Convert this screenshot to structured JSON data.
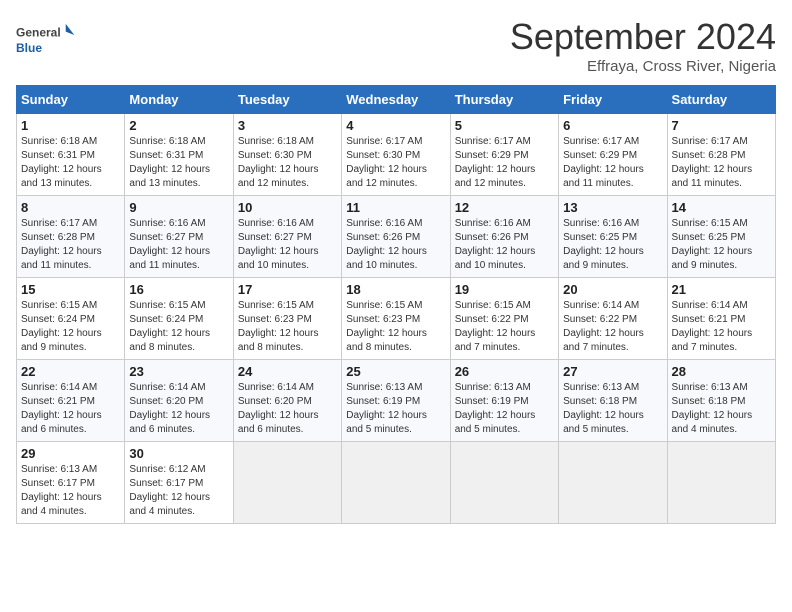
{
  "logo": {
    "general": "General",
    "blue": "Blue"
  },
  "title": "September 2024",
  "subtitle": "Effraya, Cross River, Nigeria",
  "days_of_week": [
    "Sunday",
    "Monday",
    "Tuesday",
    "Wednesday",
    "Thursday",
    "Friday",
    "Saturday"
  ],
  "weeks": [
    [
      {
        "num": "1",
        "rise": "6:18 AM",
        "set": "6:31 PM",
        "daylight": "12 hours and 13 minutes."
      },
      {
        "num": "2",
        "rise": "6:18 AM",
        "set": "6:31 PM",
        "daylight": "12 hours and 13 minutes."
      },
      {
        "num": "3",
        "rise": "6:18 AM",
        "set": "6:30 PM",
        "daylight": "12 hours and 12 minutes."
      },
      {
        "num": "4",
        "rise": "6:17 AM",
        "set": "6:30 PM",
        "daylight": "12 hours and 12 minutes."
      },
      {
        "num": "5",
        "rise": "6:17 AM",
        "set": "6:29 PM",
        "daylight": "12 hours and 12 minutes."
      },
      {
        "num": "6",
        "rise": "6:17 AM",
        "set": "6:29 PM",
        "daylight": "12 hours and 11 minutes."
      },
      {
        "num": "7",
        "rise": "6:17 AM",
        "set": "6:28 PM",
        "daylight": "12 hours and 11 minutes."
      }
    ],
    [
      {
        "num": "8",
        "rise": "6:17 AM",
        "set": "6:28 PM",
        "daylight": "12 hours and 11 minutes."
      },
      {
        "num": "9",
        "rise": "6:16 AM",
        "set": "6:27 PM",
        "daylight": "12 hours and 11 minutes."
      },
      {
        "num": "10",
        "rise": "6:16 AM",
        "set": "6:27 PM",
        "daylight": "12 hours and 10 minutes."
      },
      {
        "num": "11",
        "rise": "6:16 AM",
        "set": "6:26 PM",
        "daylight": "12 hours and 10 minutes."
      },
      {
        "num": "12",
        "rise": "6:16 AM",
        "set": "6:26 PM",
        "daylight": "12 hours and 10 minutes."
      },
      {
        "num": "13",
        "rise": "6:16 AM",
        "set": "6:25 PM",
        "daylight": "12 hours and 9 minutes."
      },
      {
        "num": "14",
        "rise": "6:15 AM",
        "set": "6:25 PM",
        "daylight": "12 hours and 9 minutes."
      }
    ],
    [
      {
        "num": "15",
        "rise": "6:15 AM",
        "set": "6:24 PM",
        "daylight": "12 hours and 9 minutes."
      },
      {
        "num": "16",
        "rise": "6:15 AM",
        "set": "6:24 PM",
        "daylight": "12 hours and 8 minutes."
      },
      {
        "num": "17",
        "rise": "6:15 AM",
        "set": "6:23 PM",
        "daylight": "12 hours and 8 minutes."
      },
      {
        "num": "18",
        "rise": "6:15 AM",
        "set": "6:23 PM",
        "daylight": "12 hours and 8 minutes."
      },
      {
        "num": "19",
        "rise": "6:15 AM",
        "set": "6:22 PM",
        "daylight": "12 hours and 7 minutes."
      },
      {
        "num": "20",
        "rise": "6:14 AM",
        "set": "6:22 PM",
        "daylight": "12 hours and 7 minutes."
      },
      {
        "num": "21",
        "rise": "6:14 AM",
        "set": "6:21 PM",
        "daylight": "12 hours and 7 minutes."
      }
    ],
    [
      {
        "num": "22",
        "rise": "6:14 AM",
        "set": "6:21 PM",
        "daylight": "12 hours and 6 minutes."
      },
      {
        "num": "23",
        "rise": "6:14 AM",
        "set": "6:20 PM",
        "daylight": "12 hours and 6 minutes."
      },
      {
        "num": "24",
        "rise": "6:14 AM",
        "set": "6:20 PM",
        "daylight": "12 hours and 6 minutes."
      },
      {
        "num": "25",
        "rise": "6:13 AM",
        "set": "6:19 PM",
        "daylight": "12 hours and 5 minutes."
      },
      {
        "num": "26",
        "rise": "6:13 AM",
        "set": "6:19 PM",
        "daylight": "12 hours and 5 minutes."
      },
      {
        "num": "27",
        "rise": "6:13 AM",
        "set": "6:18 PM",
        "daylight": "12 hours and 5 minutes."
      },
      {
        "num": "28",
        "rise": "6:13 AM",
        "set": "6:18 PM",
        "daylight": "12 hours and 4 minutes."
      }
    ],
    [
      {
        "num": "29",
        "rise": "6:13 AM",
        "set": "6:17 PM",
        "daylight": "12 hours and 4 minutes."
      },
      {
        "num": "30",
        "rise": "6:12 AM",
        "set": "6:17 PM",
        "daylight": "12 hours and 4 minutes."
      },
      null,
      null,
      null,
      null,
      null
    ]
  ]
}
